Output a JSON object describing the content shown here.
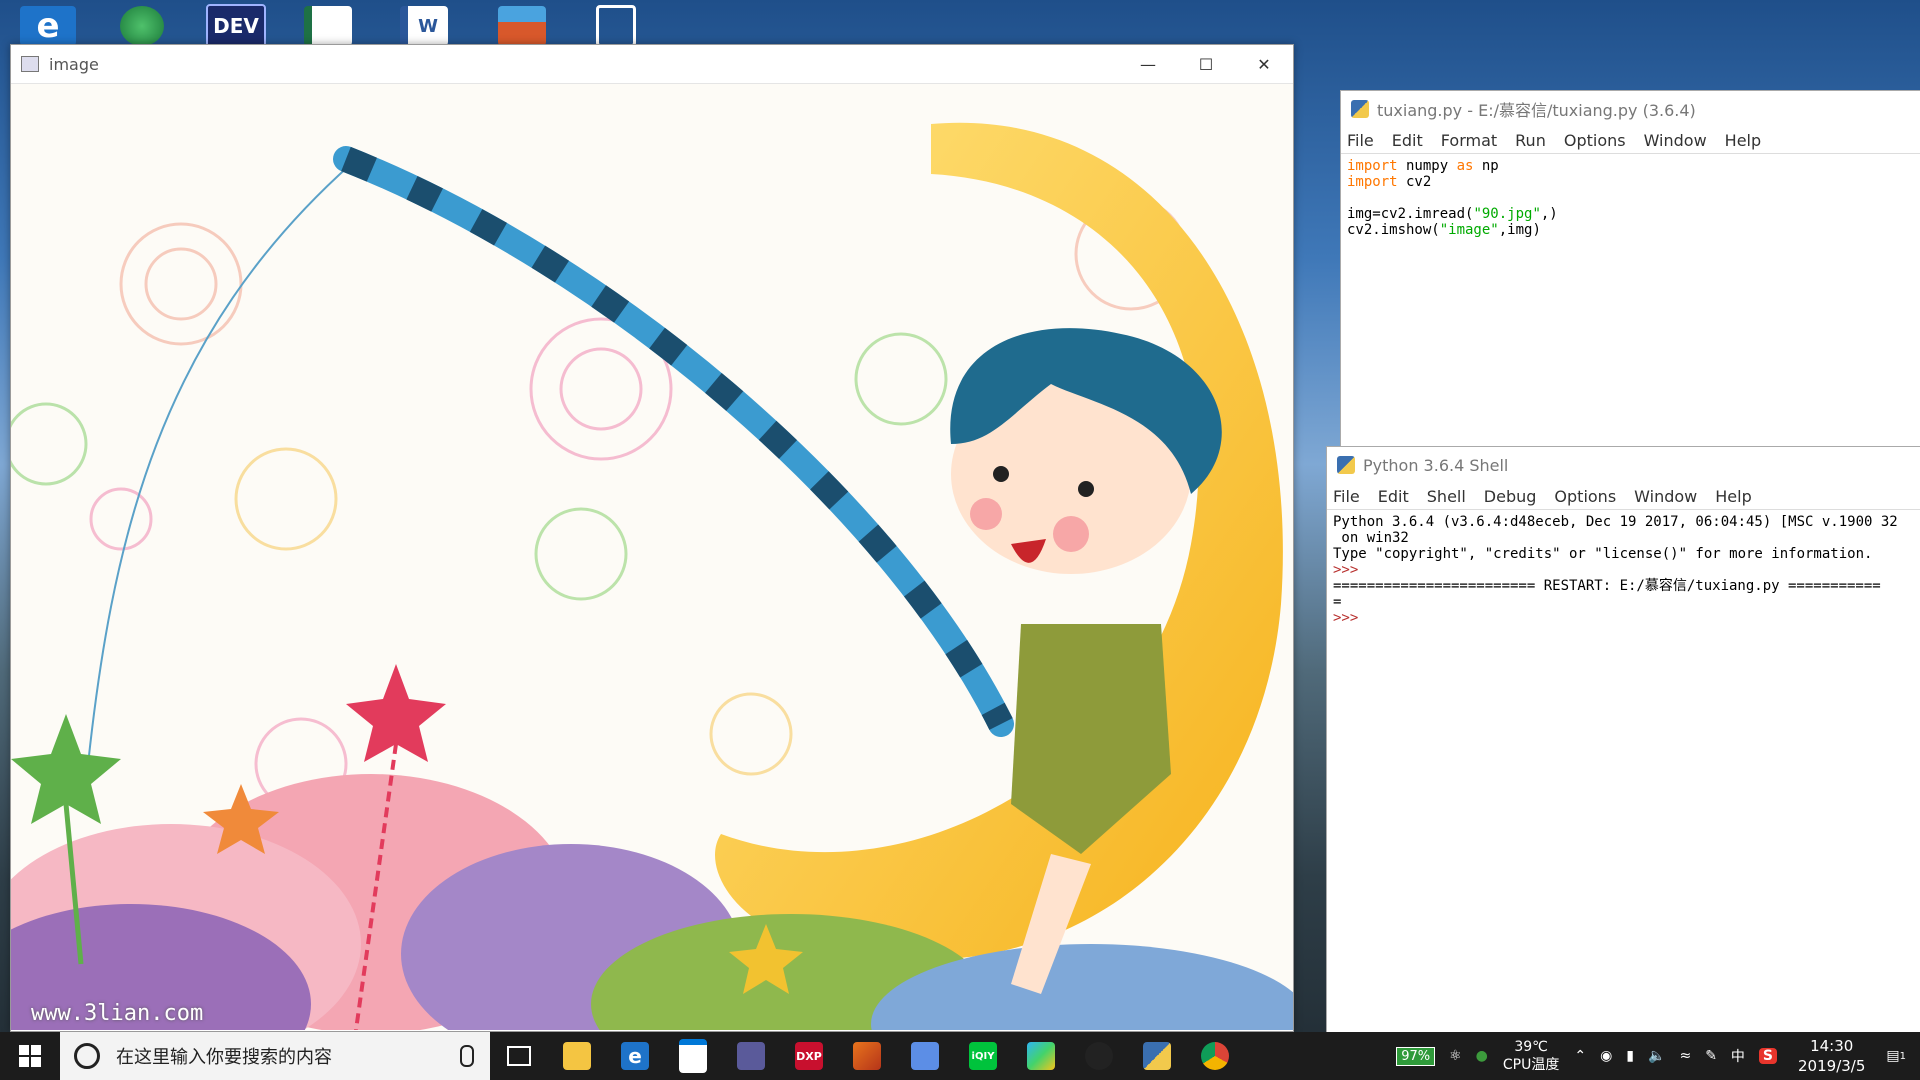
{
  "desktop": {
    "icons": [
      {
        "name": "edge-desktop-icon",
        "glyph": "e",
        "color": "#1e73c9"
      },
      {
        "name": "globe-desktop-icon",
        "glyph": "",
        "color": "#27a552"
      },
      {
        "name": "dev-desktop-icon",
        "glyph": "DEV",
        "color": "#1a2a6a"
      },
      {
        "name": "excel-desktop-icon",
        "glyph": "",
        "color": "#ffffff"
      },
      {
        "name": "word-desktop-icon",
        "glyph": "W",
        "color": "#ffffff"
      },
      {
        "name": "archive-desktop-icon",
        "glyph": "",
        "color": "#d8582b"
      },
      {
        "name": "document-desktop-icon",
        "glyph": "",
        "color": "#ffffff"
      }
    ]
  },
  "image_window": {
    "title": "image",
    "watermark": "www.3lian.com"
  },
  "editor": {
    "title": "tuxiang.py - E:/慕容信/tuxiang.py (3.6.4)",
    "menu": [
      "File",
      "Edit",
      "Format",
      "Run",
      "Options",
      "Window",
      "Help"
    ],
    "code": {
      "l1_kw": "import",
      "l1_rest": " numpy ",
      "l1_as": "as",
      "l1_np": " np",
      "l2_kw": "import",
      "l2_rest": " cv2",
      "l4_a": "img=cv2.imread(",
      "l4_str": "\"90.jpg\"",
      "l4_b": ",)",
      "l5_a": "cv2.imshow(",
      "l5_str": "\"image\"",
      "l5_b": ",img)"
    }
  },
  "shell": {
    "title": "Python 3.6.4 Shell",
    "menu": [
      "File",
      "Edit",
      "Shell",
      "Debug",
      "Options",
      "Window",
      "Help"
    ],
    "line1": "Python 3.6.4 (v3.6.4:d48eceb, Dec 19 2017, 06:04:45) [MSC v.1900 32",
    "line2": " on win32",
    "line3": "Type \"copyright\", \"credits\" or \"license()\" for more information.",
    "prompt": ">>>",
    "restart": "======================== RESTART: E:/慕容信/tuxiang.py ===========",
    "restart_cont": "="
  },
  "taskbar": {
    "search_placeholder": "在这里输入你要搜索的内容",
    "temperature": "39℃",
    "temperature_label": "CPU温度",
    "battery": "97%",
    "ime": "中",
    "time": "14:30",
    "date": "2019/3/5",
    "notifications": "1"
  }
}
